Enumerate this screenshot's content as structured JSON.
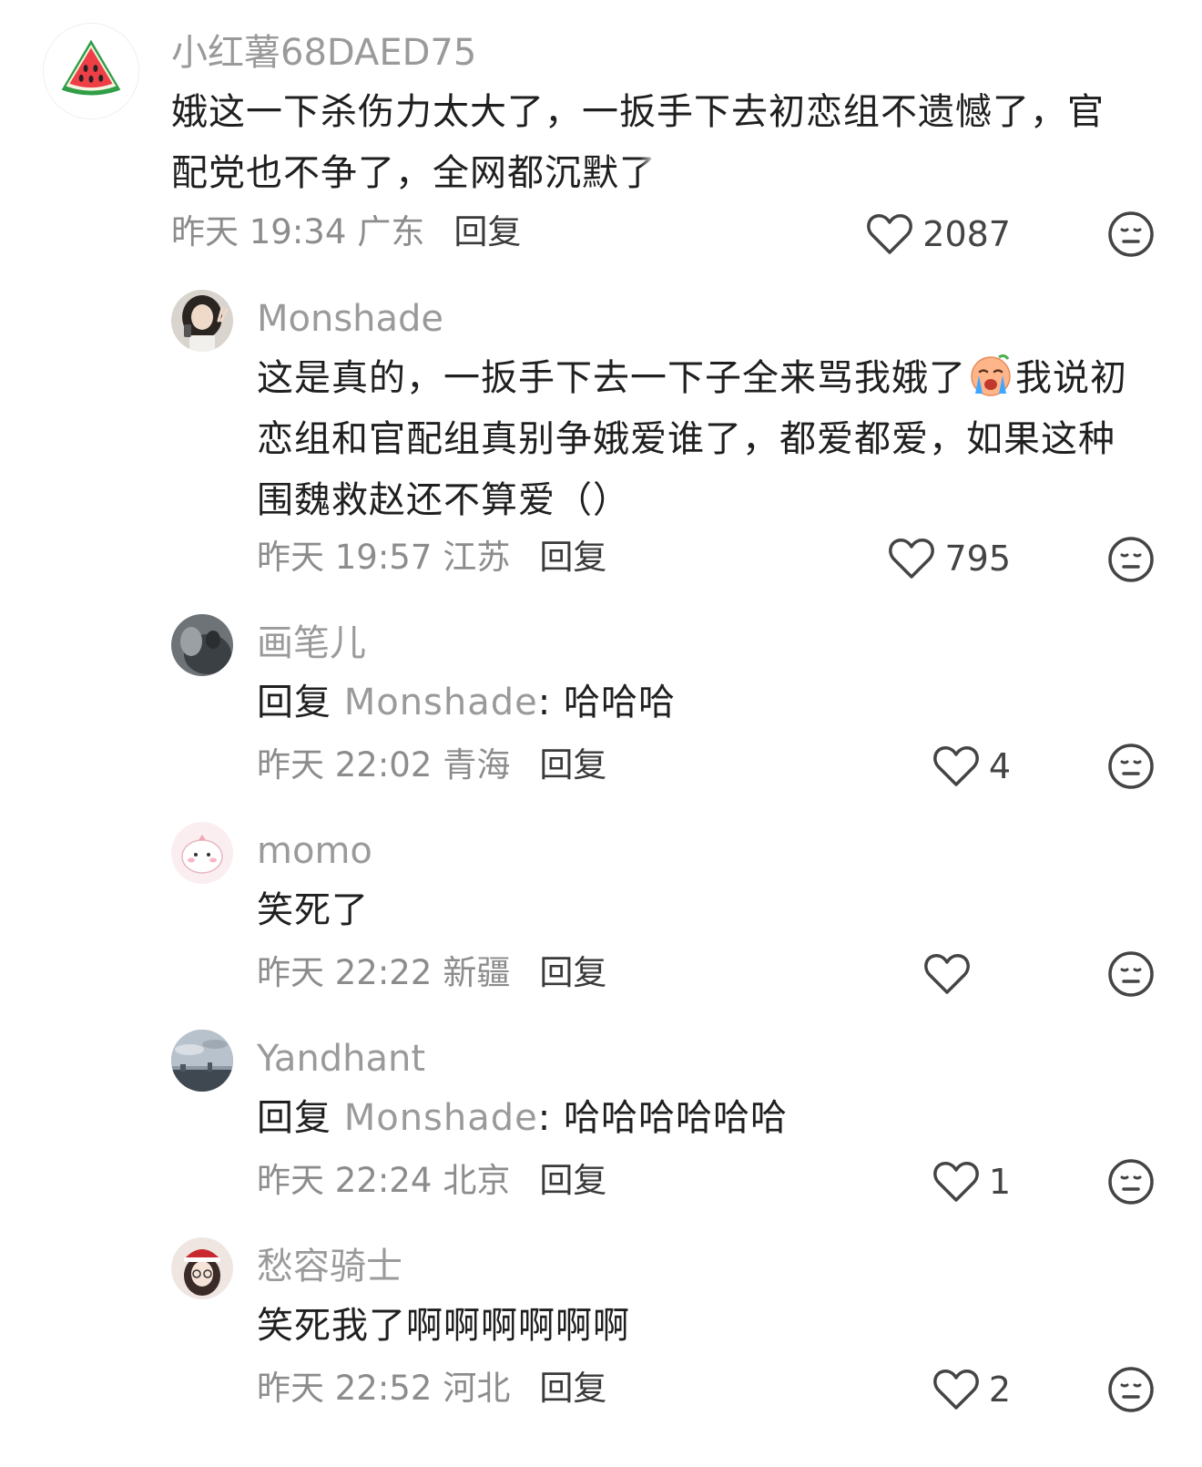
{
  "comments": [
    {
      "username": "小红薯68DAED75",
      "text": "娥这一下杀伤力太大了，一扳手下去初恋组不遗憾了，官配党也不争了，全网都沉默了",
      "text_line1": "娥这一下杀伤力太大了，一扳手下去初恋组不遗憾了，官",
      "text_line2_a": "配党也不争了，全网都沉默",
      "text_line2_b": "了",
      "time": "昨天 19:34",
      "region": "广东",
      "reply_label": "回复",
      "likes": "2087",
      "avatar": "watermelon-avatar"
    },
    {
      "username": "Monshade",
      "text_line1_a": "这是真的，一扳手下去一下子全来骂我娥了",
      "text_line1_b": "我说初",
      "text_line2": "恋组和官配组真别争娥爱谁了，都爱都爱，如果这种",
      "text_line3": "围魏救赵还不算爱（）",
      "emoji": "sob-emoji",
      "time": "昨天 19:57",
      "region": "江苏",
      "reply_label": "回复",
      "likes": "795"
    },
    {
      "username": "画笔儿",
      "reply_prefix": "回复",
      "reply_to": "Monshade",
      "colon": ":",
      "text": "哈哈哈",
      "time": "昨天 22:02",
      "region": "青海",
      "reply_label": "回复",
      "likes": "4"
    },
    {
      "username": "momo",
      "text": "笑死了",
      "time": "昨天 22:22",
      "region": "新疆",
      "reply_label": "回复",
      "likes": ""
    },
    {
      "username": "Yandhant",
      "reply_prefix": "回复",
      "reply_to": "Monshade",
      "colon": ":",
      "text": "哈哈哈哈哈哈",
      "time": "昨天 22:24",
      "region": "北京",
      "reply_label": "回复",
      "likes": "1"
    },
    {
      "username": "愁容骑士",
      "text": "笑死我了啊啊啊啊啊啊",
      "time": "昨天 22:52",
      "region": "河北",
      "reply_label": "回复",
      "likes": "2"
    }
  ],
  "icons": {
    "like": "heart-outline-icon",
    "dislike": "meh-face-icon"
  },
  "colors": {
    "username": "#9a9a9a",
    "body_text": "#1f1f1f",
    "meta": "#8c8c8c"
  }
}
